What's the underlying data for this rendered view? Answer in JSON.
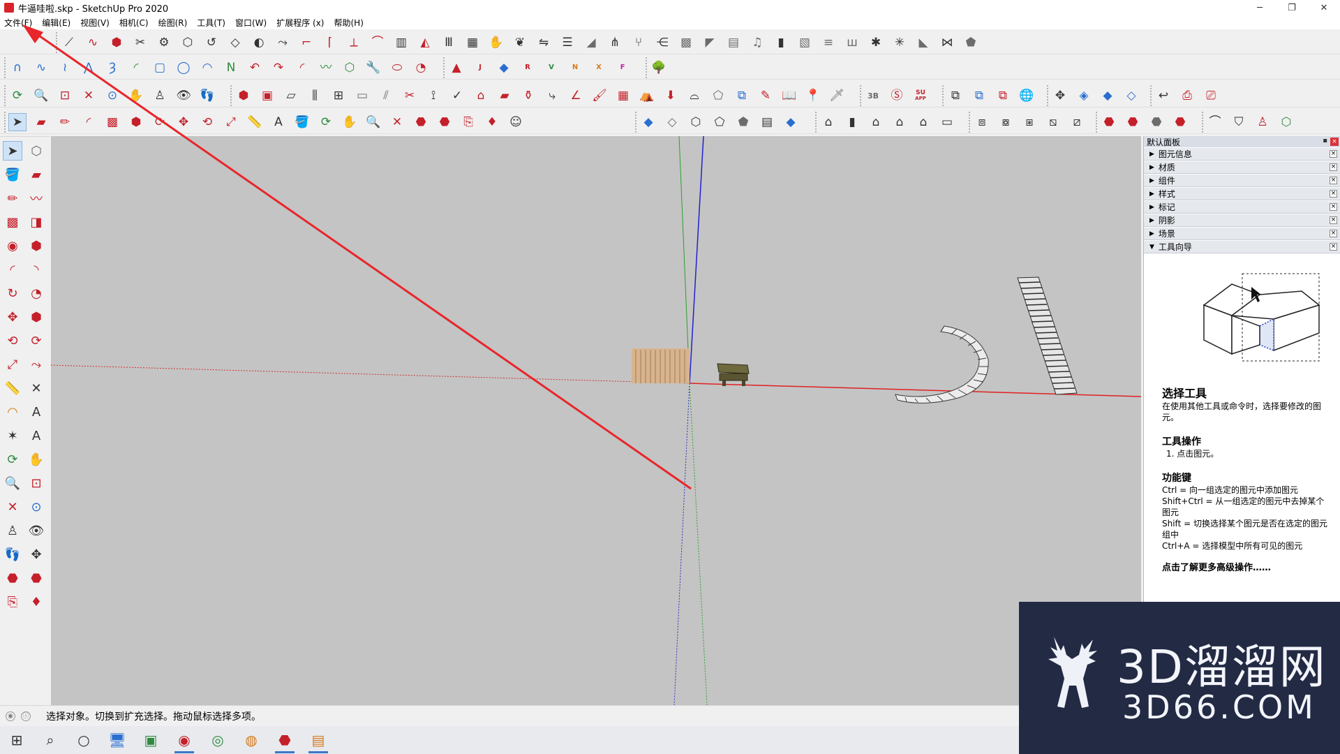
{
  "window": {
    "title": "牛逼哇啦.skp - SketchUp Pro 2020",
    "controls": [
      "─",
      "❐",
      "✕"
    ]
  },
  "menu": [
    "文件(F)",
    "编辑(E)",
    "视图(V)",
    "相机(C)",
    "绘图(R)",
    "工具(T)",
    "窗口(W)",
    "扩展程序 (x)",
    "帮助(H)"
  ],
  "toolbar_row2_labels": {
    "j": "J",
    "r": "R",
    "v": "V",
    "n": "N",
    "x": "X",
    "f": "F"
  },
  "toolbar_row3_labels": {
    "b3": "3B",
    "su": "SU",
    "app": "APP"
  },
  "tray": {
    "title": "默认面板",
    "panels": [
      "图元信息",
      "材质",
      "组件",
      "样式",
      "标记",
      "阴影",
      "场景",
      "工具向导"
    ],
    "guide": {
      "tool_title": "选择工具",
      "tool_desc": "在使用其他工具或命令时，选择要修改的图元。",
      "ops_title": "工具操作",
      "ops_step": "1. 点击图元。",
      "keys_title": "功能键",
      "keys": [
        "Ctrl = 向一组选定的图元中添加图元",
        "Shift+Ctrl = 从一组选定的图元中去掉某个图元",
        "Shift = 切换选择某个图元是否在选定的图元组中",
        "Ctrl+A = 选择模型中所有可见的图元"
      ],
      "more": "点击了解更多高级操作……"
    }
  },
  "status": {
    "text": "选择对象。切换到扩充选择。拖动鼠标选择多项。"
  },
  "watermark": {
    "brand": "3D溜溜网",
    "domain": "3D66.COM"
  },
  "colors": {
    "viewport_bg": "#c4c4c4",
    "axis_red": "#e02020",
    "axis_green": "#2e9e2e",
    "axis_blue": "#2020d0",
    "annotation_arrow": "#e8262b",
    "watermark_bg": "#232a44"
  }
}
